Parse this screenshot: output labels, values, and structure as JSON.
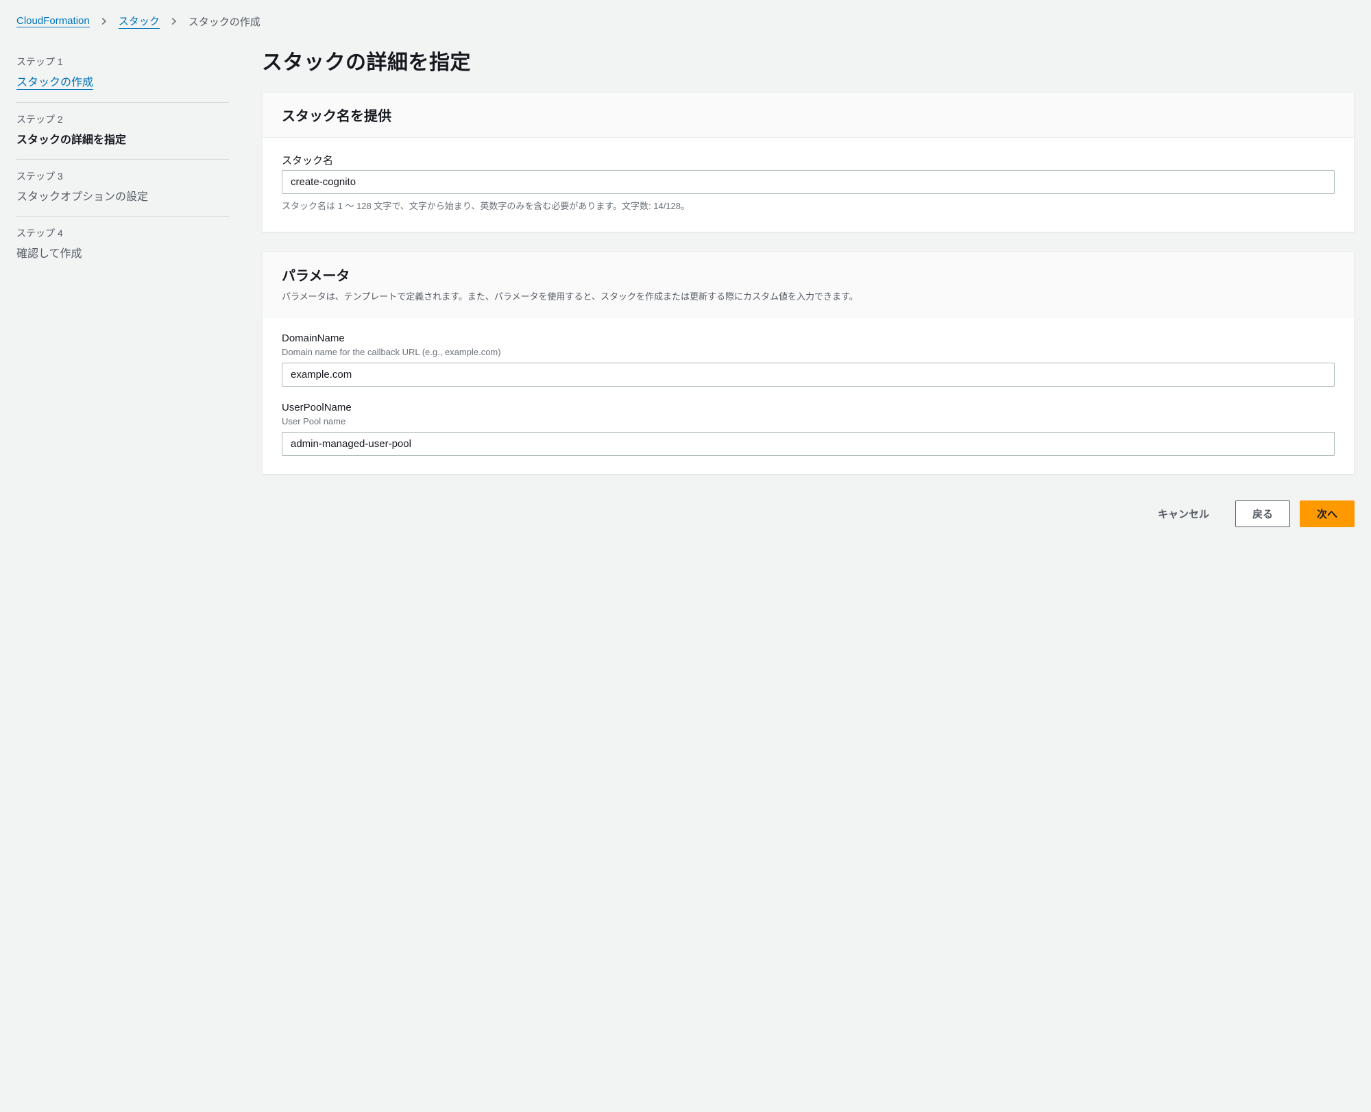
{
  "breadcrumb": {
    "items": [
      {
        "label": "CloudFormation",
        "link": true
      },
      {
        "label": "スタック",
        "link": true
      },
      {
        "label": "スタックの作成",
        "link": false
      }
    ]
  },
  "steps": [
    {
      "label": "ステップ 1",
      "title": "スタックの作成",
      "state": "link"
    },
    {
      "label": "ステップ 2",
      "title": "スタックの詳細を指定",
      "state": "active"
    },
    {
      "label": "ステップ 3",
      "title": "スタックオプションの設定",
      "state": ""
    },
    {
      "label": "ステップ 4",
      "title": "確認して作成",
      "state": ""
    }
  ],
  "page": {
    "title": "スタックの詳細を指定"
  },
  "stackNamePanel": {
    "heading": "スタック名を提供",
    "fieldLabel": "スタック名",
    "value": "create-cognito",
    "help": "スタック名は 1 〜 128 文字で、文字から始まり、英数字のみを含む必要があります。文字数: 14/128。"
  },
  "parametersPanel": {
    "heading": "パラメータ",
    "description": "パラメータは、テンプレートで定義されます。また、パラメータを使用すると、スタックを作成または更新する際にカスタム値を入力できます。",
    "fields": [
      {
        "label": "DomainName",
        "hint": "Domain name for the callback URL (e.g., example.com)",
        "value": "example.com"
      },
      {
        "label": "UserPoolName",
        "hint": "User Pool name",
        "value": "admin-managed-user-pool"
      }
    ]
  },
  "actions": {
    "cancel": "キャンセル",
    "back": "戻る",
    "next": "次へ"
  }
}
